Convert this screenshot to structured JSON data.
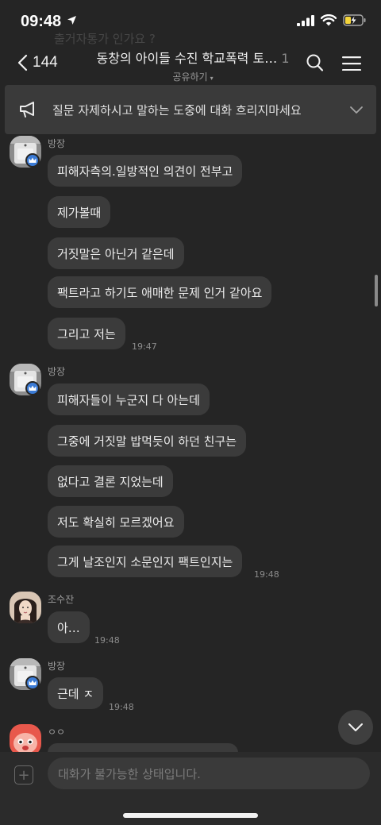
{
  "status_bar": {
    "time": "09:48"
  },
  "background_ghost_text": "출거자통가 인가요 ?",
  "header": {
    "back_count": "144",
    "title": "동창의 아이들 수진 학교폭력 토…",
    "member_count": "1",
    "share_label": "공유하기",
    "share_caret": "▾"
  },
  "notice": {
    "text": "질문 자제하시고 말하는 도중에 대화 흐리지마세요"
  },
  "messages": {
    "g1": {
      "sender": "방장",
      "bubbles": [
        "피해자측의.일방적인 의견이 전부고",
        "제가볼때",
        "거짓말은 아닌거 같은데",
        "팩트라고 하기도 애매한 문제 인거 같아요",
        "그리고 저는"
      ],
      "time": "19:47"
    },
    "g2": {
      "sender": "방장",
      "bubbles": [
        "피해자들이 누군지 다 아는데",
        "그중에 거짓말 밥먹듯이 하던 친구는",
        "없다고 결론 지었는데",
        "저도 확실히 모르겠어요",
        "그게 날조인지 소문인지 팩트인지는"
      ],
      "time": "19:48"
    },
    "g3": {
      "sender": "조수잔",
      "bubbles": [
        "아…"
      ],
      "time": "19:48"
    },
    "g4": {
      "sender": "방장",
      "bubbles": [
        "근데 ㅈ"
      ],
      "time": "19:48"
    },
    "g5": {
      "sender": "ㅇㅇ"
    }
  },
  "input": {
    "plus": "+",
    "placeholder": "대화가 불가능한 상태입니다."
  },
  "colors": {
    "background": "#252525",
    "bubble": "#3b3b3b",
    "notice": "#3a3a3a",
    "crown_badge": "#3b7bd6"
  }
}
